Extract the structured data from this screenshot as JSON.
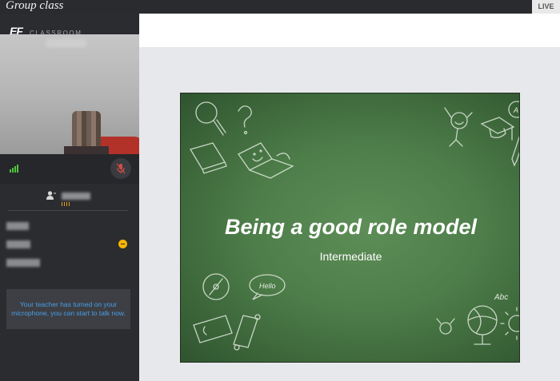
{
  "window": {
    "title": "Group class",
    "live_label": "LIVE"
  },
  "brand": {
    "logo": "EF",
    "name": "CLASSROOM"
  },
  "video": {
    "icons": {
      "signal": "signal-icon",
      "mic": "mic-muted-icon"
    },
    "colors": {
      "signal": "#4fc43e",
      "mic_muted": "#d24d44"
    }
  },
  "self": {
    "icon": "user-icon"
  },
  "participants": {
    "hand_icon": "raise-hand-icon"
  },
  "notice": {
    "text": "Your teacher has turned on your microphone, you can start to talk now."
  },
  "slide": {
    "title": "Being a good role model",
    "subtitle": "Intermediate",
    "doodle_texts": [
      "Hello",
      "Abc",
      "A"
    ]
  }
}
